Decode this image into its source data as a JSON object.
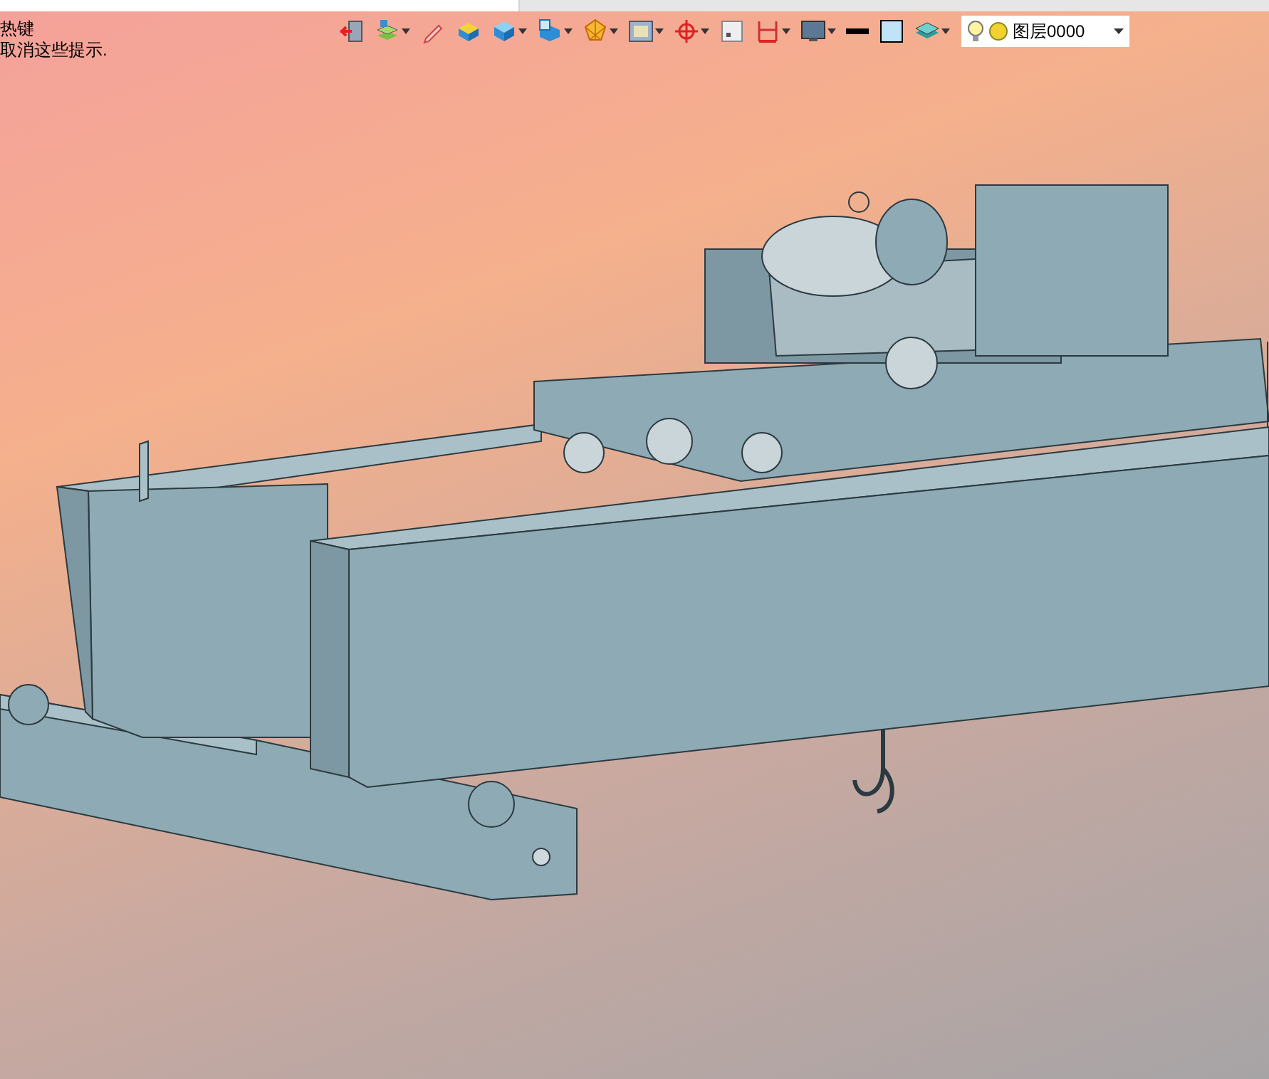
{
  "hints": [
    "热键",
    "取消这些提示."
  ],
  "toolbar": [
    {
      "kind": "exit",
      "dropdown": false
    },
    {
      "kind": "layers-paint",
      "dropdown": true
    },
    {
      "kind": "pencil",
      "dropdown": false
    },
    {
      "kind": "box-top",
      "dropdown": false
    },
    {
      "kind": "cube",
      "dropdown": true
    },
    {
      "kind": "cube-screen",
      "dropdown": true
    },
    {
      "kind": "polygon",
      "dropdown": true
    },
    {
      "kind": "frame",
      "dropdown": true
    },
    {
      "kind": "crosshair",
      "dropdown": true
    },
    {
      "kind": "small-frame",
      "dropdown": false
    },
    {
      "kind": "bracket",
      "dropdown": true
    },
    {
      "kind": "monitor",
      "dropdown": true
    },
    {
      "kind": "line",
      "dropdown": false
    },
    {
      "kind": "swatch",
      "dropdown": false
    },
    {
      "kind": "stack",
      "dropdown": true
    }
  ],
  "layer": {
    "value": "图层0000",
    "light_on": true
  }
}
